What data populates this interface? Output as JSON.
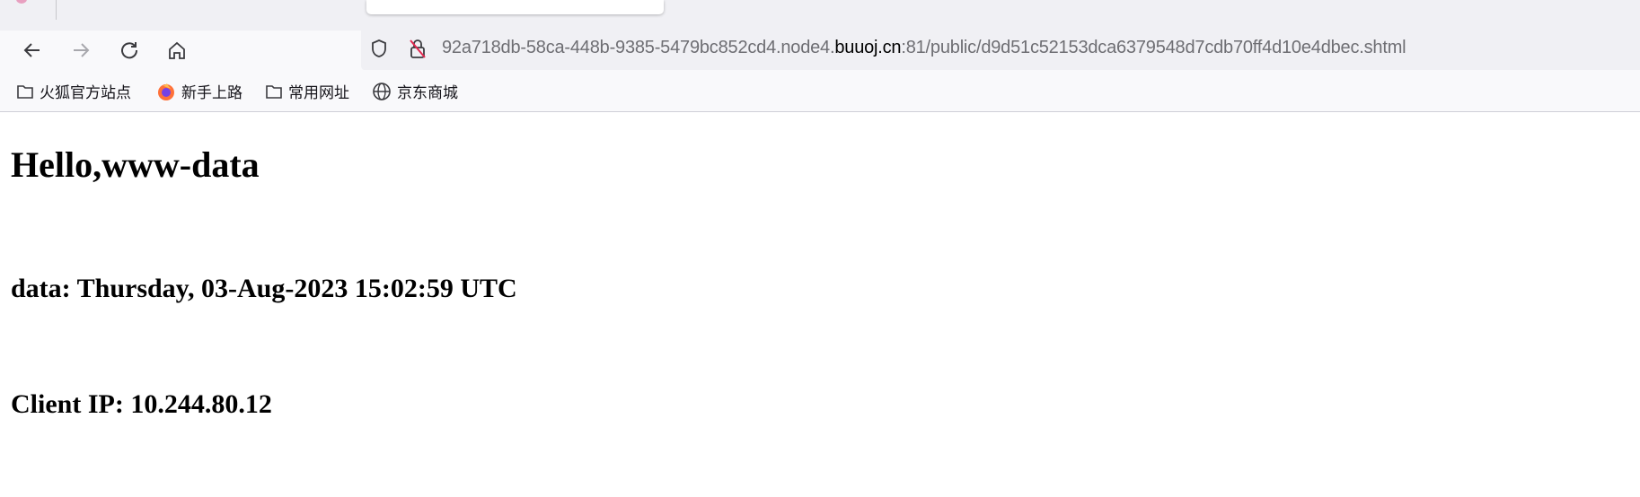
{
  "browser": {
    "url": {
      "prefix": "92a718db-58ca-448b-9385-5479bc852cd4.node4.",
      "host": "buuoj.cn",
      "suffix": ":81/public/d9d51c52153dca6379548d7cdb70ff4d10e4dbec.shtml"
    },
    "bookmarks": [
      {
        "label": "火狐官方站点",
        "icon": "folder-icon"
      },
      {
        "label": "新手上路",
        "icon": "firefox-icon"
      },
      {
        "label": "常用网址",
        "icon": "folder-icon"
      },
      {
        "label": "京东商城",
        "icon": "globe-icon"
      }
    ]
  },
  "page": {
    "heading": "Hello,www-data",
    "date_line": "data: Thursday, 03-Aug-2023 15:02:59 UTC",
    "ip_line": "Client IP: 10.244.80.12"
  }
}
